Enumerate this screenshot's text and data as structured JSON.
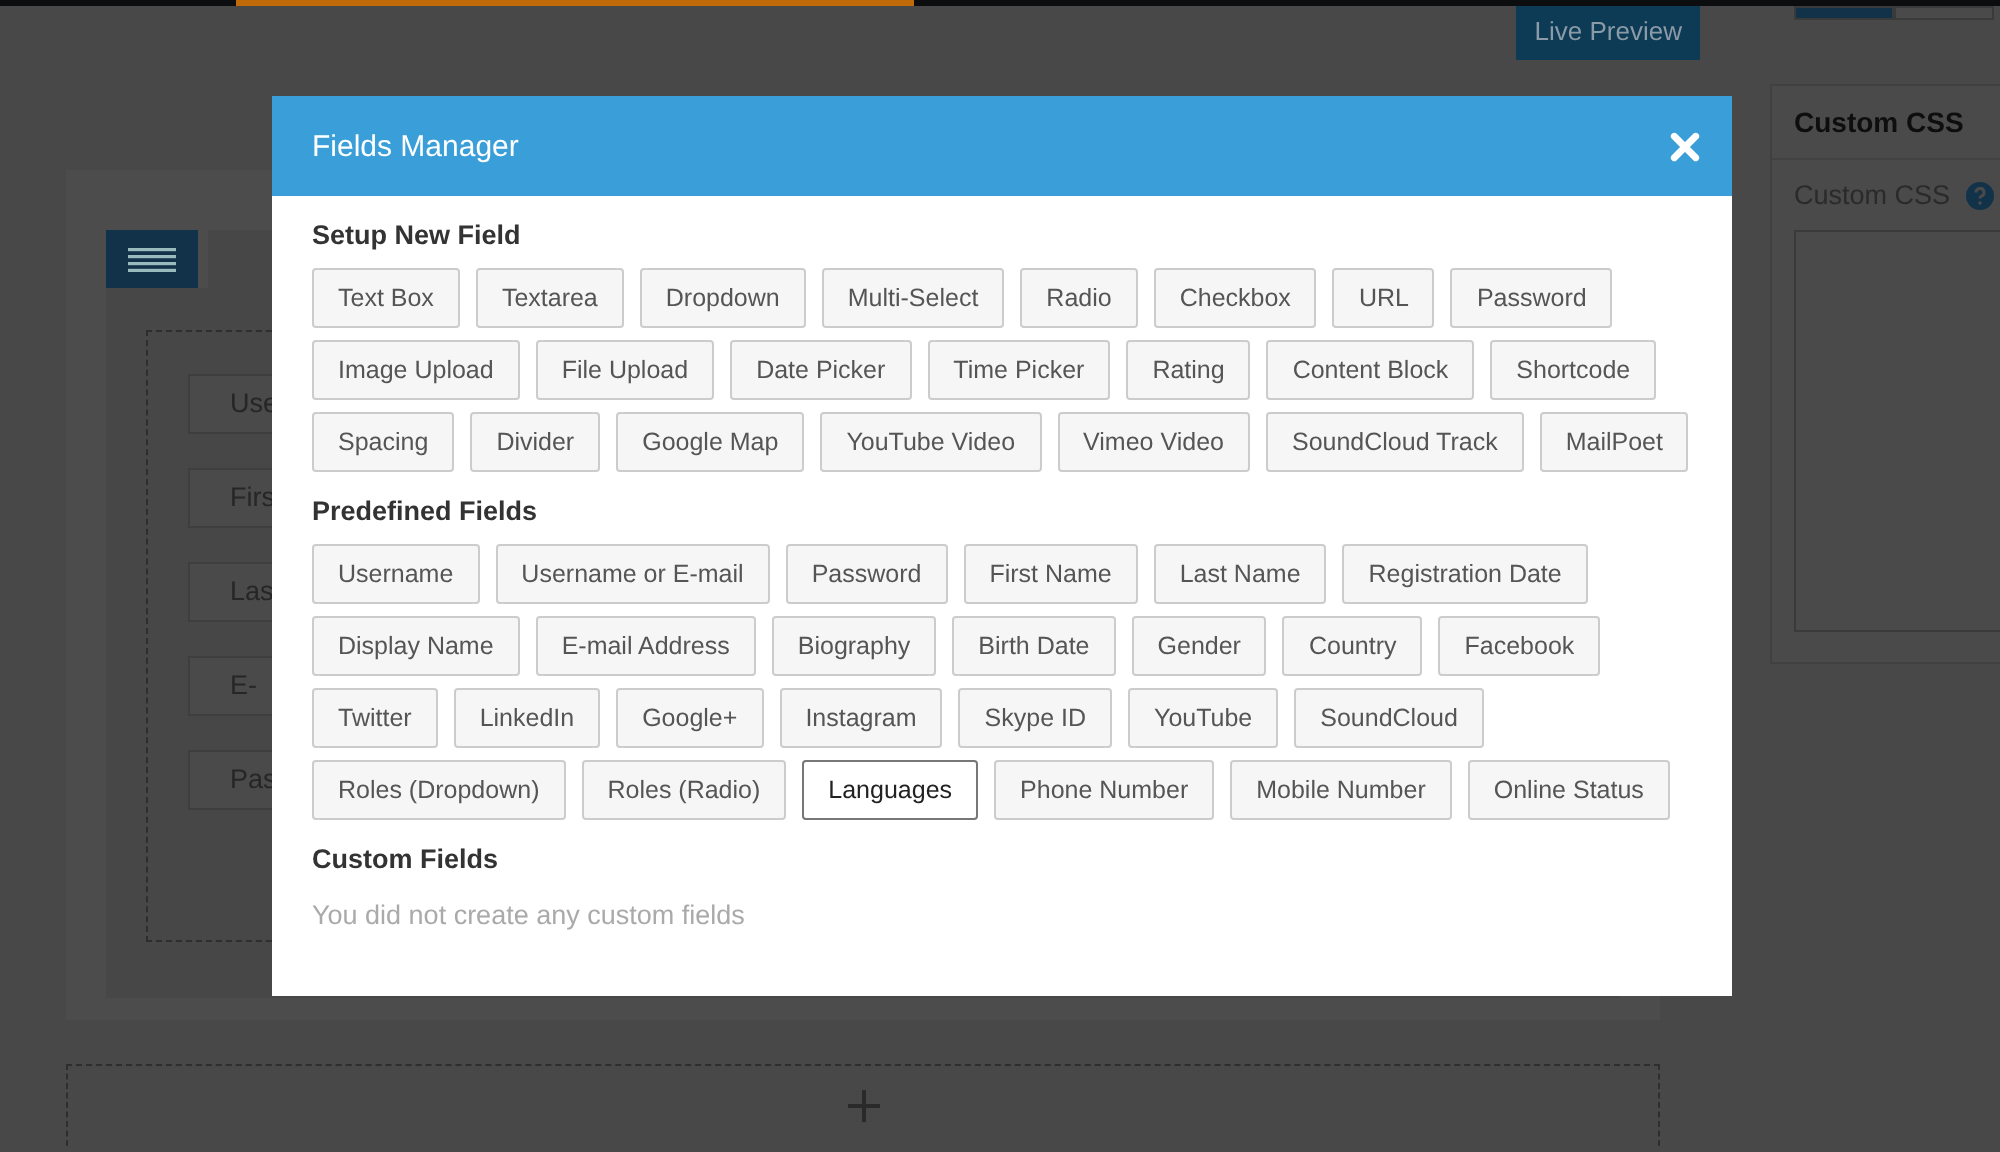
{
  "page": {
    "live_preview": "Live Preview",
    "builder_rows": [
      "Use",
      "Firs",
      "Las",
      "E-",
      "Pas"
    ],
    "sidebar_panel": {
      "title": "Custom CSS",
      "field_label": "Custom CSS"
    }
  },
  "modal": {
    "title": "Fields Manager",
    "sections": [
      {
        "title": "Setup New Field",
        "items": [
          {
            "label": "Text Box",
            "selected": false
          },
          {
            "label": "Textarea",
            "selected": false
          },
          {
            "label": "Dropdown",
            "selected": false
          },
          {
            "label": "Multi-Select",
            "selected": false
          },
          {
            "label": "Radio",
            "selected": false
          },
          {
            "label": "Checkbox",
            "selected": false
          },
          {
            "label": "URL",
            "selected": false
          },
          {
            "label": "Password",
            "selected": false
          },
          {
            "label": "Image Upload",
            "selected": false
          },
          {
            "label": "File Upload",
            "selected": false
          },
          {
            "label": "Date Picker",
            "selected": false
          },
          {
            "label": "Time Picker",
            "selected": false
          },
          {
            "label": "Rating",
            "selected": false
          },
          {
            "label": "Content Block",
            "selected": false
          },
          {
            "label": "Shortcode",
            "selected": false
          },
          {
            "label": "Spacing",
            "selected": false
          },
          {
            "label": "Divider",
            "selected": false
          },
          {
            "label": "Google Map",
            "selected": false
          },
          {
            "label": "YouTube Video",
            "selected": false
          },
          {
            "label": "Vimeo Video",
            "selected": false
          },
          {
            "label": "SoundCloud Track",
            "selected": false
          },
          {
            "label": "MailPoet",
            "selected": false
          }
        ]
      },
      {
        "title": "Predefined Fields",
        "items": [
          {
            "label": "Username",
            "selected": false
          },
          {
            "label": "Username or E-mail",
            "selected": false
          },
          {
            "label": "Password",
            "selected": false
          },
          {
            "label": "First Name",
            "selected": false
          },
          {
            "label": "Last Name",
            "selected": false
          },
          {
            "label": "Registration Date",
            "selected": false
          },
          {
            "label": "Display Name",
            "selected": false
          },
          {
            "label": "E-mail Address",
            "selected": false
          },
          {
            "label": "Biography",
            "selected": false
          },
          {
            "label": "Birth Date",
            "selected": false
          },
          {
            "label": "Gender",
            "selected": false
          },
          {
            "label": "Country",
            "selected": false
          },
          {
            "label": "Facebook",
            "selected": false
          },
          {
            "label": "Twitter",
            "selected": false
          },
          {
            "label": "LinkedIn",
            "selected": false
          },
          {
            "label": "Google+",
            "selected": false
          },
          {
            "label": "Instagram",
            "selected": false
          },
          {
            "label": "Skype ID",
            "selected": false
          },
          {
            "label": "YouTube",
            "selected": false
          },
          {
            "label": "SoundCloud",
            "selected": false
          },
          {
            "label": "Roles (Dropdown)",
            "selected": false
          },
          {
            "label": "Roles (Radio)",
            "selected": false
          },
          {
            "label": "Languages",
            "selected": true
          },
          {
            "label": "Phone Number",
            "selected": false
          },
          {
            "label": "Mobile Number",
            "selected": false
          },
          {
            "label": "Online Status",
            "selected": false
          }
        ]
      },
      {
        "title": "Custom Fields",
        "empty_message": "You did not create any custom fields"
      }
    ]
  }
}
